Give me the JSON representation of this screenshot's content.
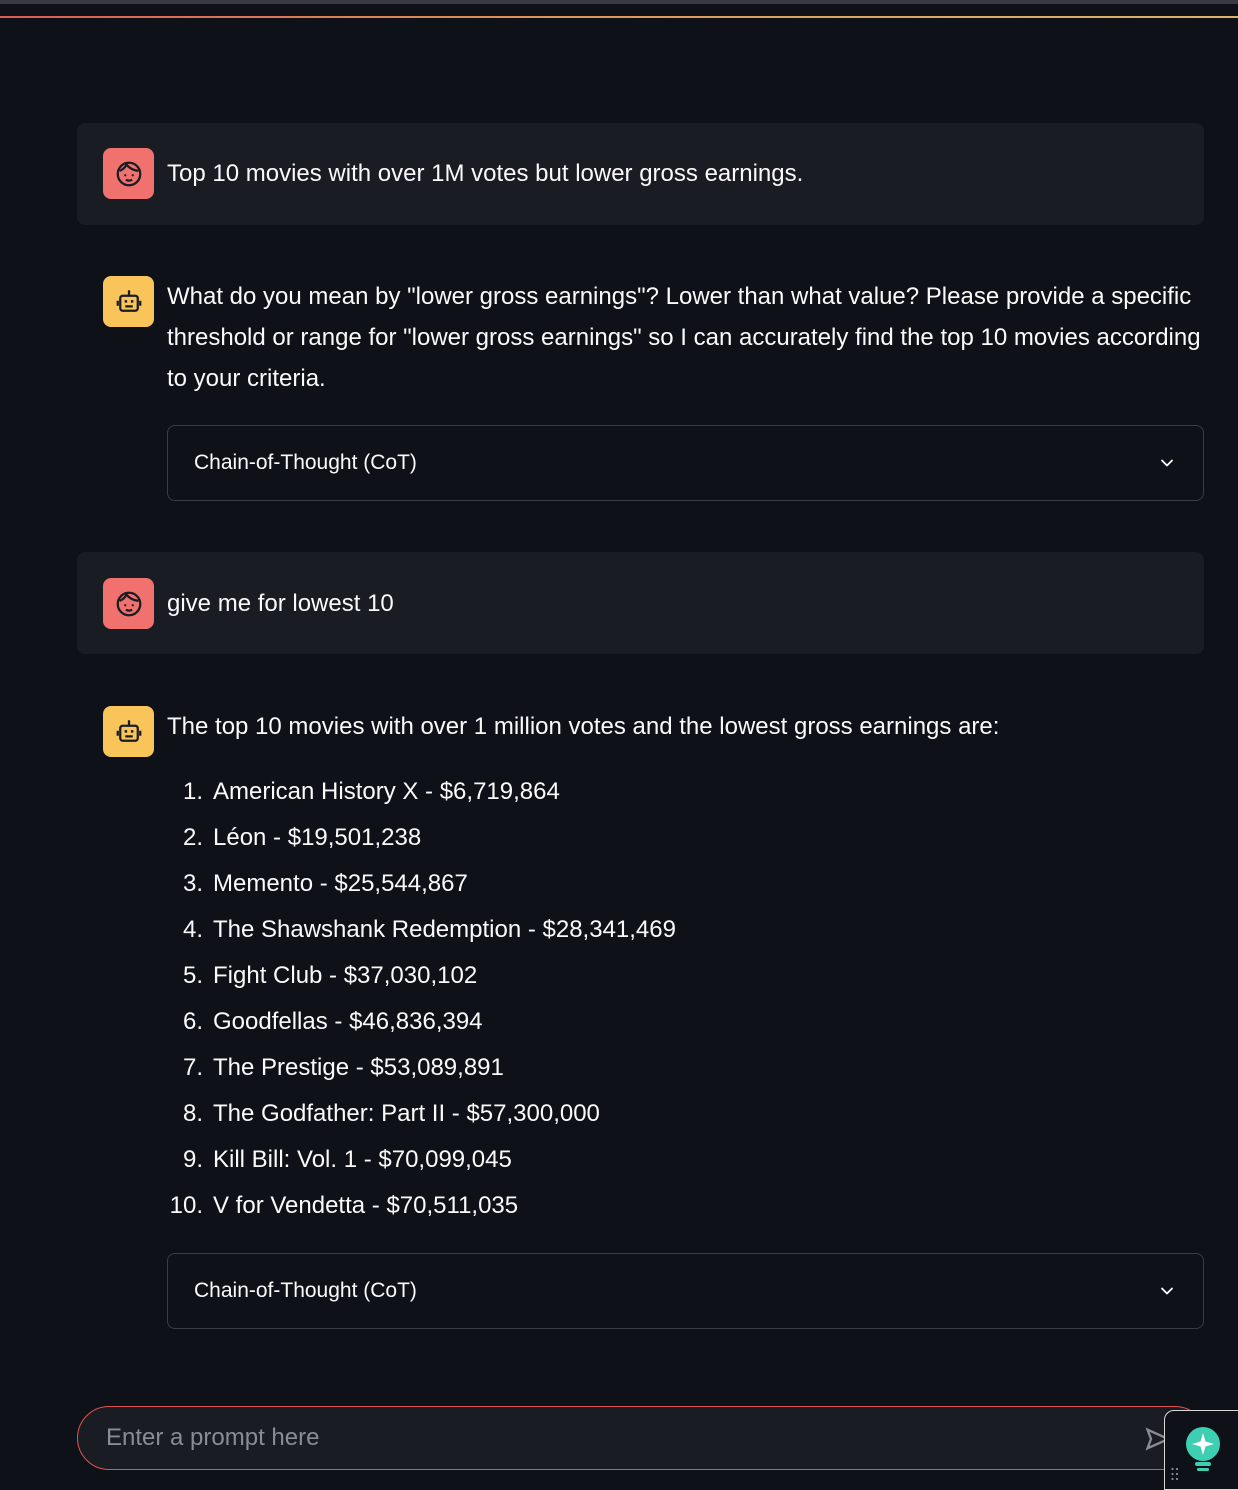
{
  "messages": [
    {
      "role": "user",
      "avatar_icon": "user-face-icon",
      "text": "Top 10 movies with over 1M votes but lower gross earnings."
    },
    {
      "role": "assistant",
      "avatar_icon": "robot-icon",
      "text": "What do you mean by \"lower gross earnings\"? Lower than what value? Please provide a specific threshold or range for \"lower gross earnings\" so I can accurately find the top 10 movies according to your criteria.",
      "expander_label": "Chain-of-Thought (CoT)"
    },
    {
      "role": "user",
      "avatar_icon": "user-face-icon",
      "text": "give me for lowest 10"
    },
    {
      "role": "assistant",
      "avatar_icon": "robot-icon",
      "text": "The top 10 movies with over 1 million votes and the lowest gross earnings are:",
      "list": [
        {
          "num": "1.",
          "text": "American History X - $6,719,864"
        },
        {
          "num": "2.",
          "text": "Léon - $19,501,238"
        },
        {
          "num": "3.",
          "text": "Memento - $25,544,867"
        },
        {
          "num": "4.",
          "text": "The Shawshank Redemption - $28,341,469"
        },
        {
          "num": "5.",
          "text": "Fight Club - $37,030,102"
        },
        {
          "num": "6.",
          "text": "Goodfellas - $46,836,394"
        },
        {
          "num": "7.",
          "text": "The Prestige - $53,089,891"
        },
        {
          "num": "8.",
          "text": "The Godfather: Part II - $57,300,000"
        },
        {
          "num": "9.",
          "text": "Kill Bill: Vol. 1 - $70,099,045"
        },
        {
          "num": "10.",
          "text": "V for Vendetta - $70,511,035"
        }
      ],
      "expander_label": "Chain-of-Thought (CoT)"
    }
  ],
  "chat_input": {
    "placeholder": "Enter a prompt here",
    "value": ""
  },
  "icons": {
    "expander": "chevron-down-icon",
    "send": "send-icon",
    "assistant_widget": "lightbulb-icon",
    "drag_handle": "grip-dots-icon"
  },
  "colors": {
    "background": "#0e1117",
    "user_message_bg": "#1a1c24",
    "user_avatar": "#f0716d",
    "assistant_avatar": "#f9c55b",
    "input_border": "#e0524f",
    "widget_accent": "#3ecfb2"
  }
}
